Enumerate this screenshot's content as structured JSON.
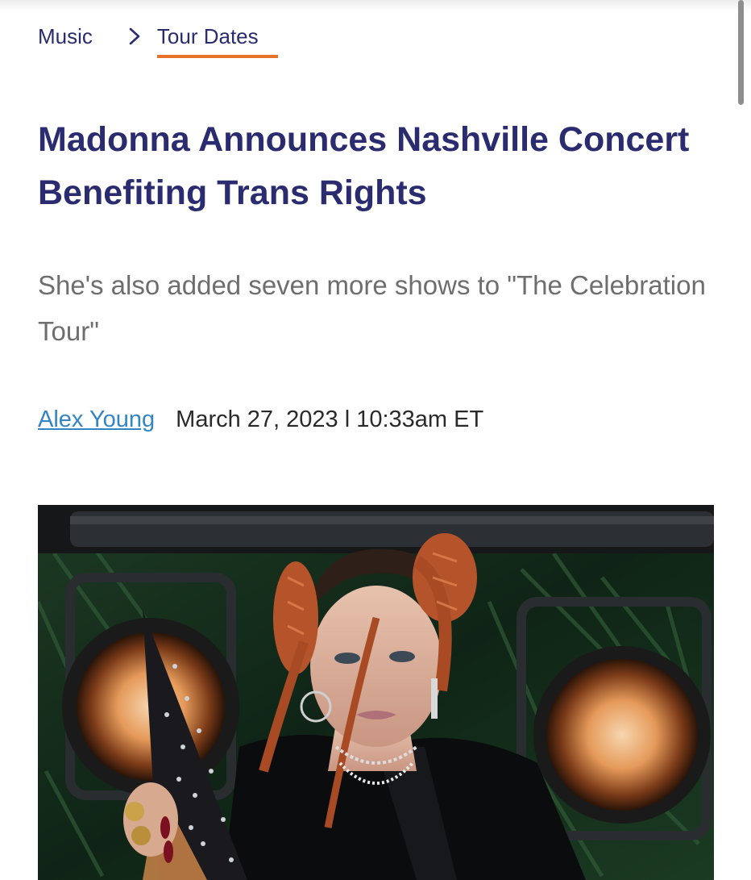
{
  "breadcrumb": {
    "items": [
      {
        "label": "Music"
      },
      {
        "label": "Tour Dates"
      }
    ]
  },
  "article": {
    "headline": "Madonna Announces Nashville Concert Benefiting Trans Rights",
    "dek": "She's also added seven more shows to \"The Celebration Tour\"",
    "author": "Alex Young",
    "datetime": "March 27, 2023 l 10:33am ET"
  },
  "hero_image": {
    "description_icon": "photo"
  },
  "colors": {
    "nav_text": "#2b2c70",
    "headline": "#2b2c70",
    "accent_underline": "#e8712c",
    "dek": "#6e6e6e",
    "author_link": "#3485c3",
    "body_text": "#2a2a2a"
  }
}
